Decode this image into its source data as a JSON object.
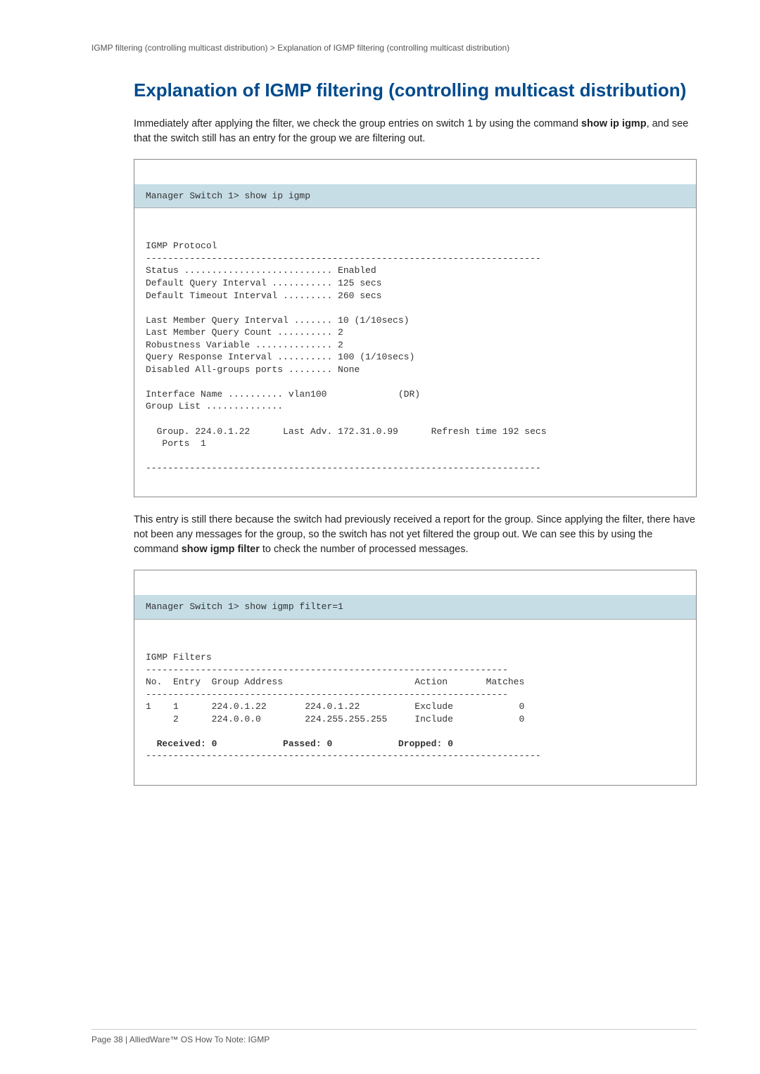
{
  "breadcrumb": "IGMP filtering (controlling multicast distribution)  >   Explanation of IGMP filtering (controlling multicast distribution)",
  "heading_part1": "Explanation of ",
  "heading_igmp": "IGMP",
  "heading_part2": " filtering (controlling multicast distribution)",
  "para1_a": "Immediately after applying the filter, we check the group entries on switch 1 by using the command ",
  "para1_cmd": "show ip igmp",
  "para1_b": ", and see that the switch still has an entry for the group we are filtering out.",
  "code1_header": "Manager Switch 1> show ip igmp",
  "code1_body": "IGMP Protocol\n------------------------------------------------------------------------\nStatus ........................... Enabled\nDefault Query Interval ........... 125 secs\nDefault Timeout Interval ......... 260 secs\n\nLast Member Query Interval ....... 10 (1/10secs)\nLast Member Query Count .......... 2\nRobustness Variable .............. 2\nQuery Response Interval .......... 100 (1/10secs)\nDisabled All-groups ports ........ None\n\nInterface Name .......... vlan100             (DR)\nGroup List ..............\n\n  Group. 224.0.1.22      Last Adv. 172.31.0.99      Refresh time 192 secs\n   Ports  1\n\n------------------------------------------------------------------------",
  "para2_a": "This entry is still there because the switch had previously received a report for the group. Since applying the filter, there have not been any messages for the group, so the switch has not yet filtered the group out. We can see this by using the command ",
  "para2_cmd": "show igmp filter",
  "para2_b": " to check the number of processed messages.",
  "code2_header": "Manager Switch 1> show igmp filter=1",
  "code2_body": "IGMP Filters\n------------------------------------------------------------------\nNo.  Entry  Group Address                        Action       Matches\n------------------------------------------------------------------\n1    1      224.0.1.22       224.0.1.22          Exclude            0\n     2      224.0.0.0        224.255.255.255     Include            0\n\n  Received: 0            Passed: 0            Dropped: 0\n------------------------------------------------------------------------",
  "footer": "Page 38 | AlliedWare™ OS How To Note: IGMP",
  "chart_data": {
    "type": "table",
    "title": "IGMP Filters",
    "columns": [
      "No.",
      "Entry",
      "Group Address Start",
      "Group Address End",
      "Action",
      "Matches"
    ],
    "rows": [
      [
        1,
        1,
        "224.0.1.22",
        "224.0.1.22",
        "Exclude",
        0
      ],
      [
        "",
        2,
        "224.0.0.0",
        "224.255.255.255",
        "Include",
        0
      ]
    ],
    "summary": {
      "Received": 0,
      "Passed": 0,
      "Dropped": 0
    },
    "igmp_protocol": {
      "Status": "Enabled",
      "Default Query Interval": "125 secs",
      "Default Timeout Interval": "260 secs",
      "Last Member Query Interval": "10 (1/10secs)",
      "Last Member Query Count": 2,
      "Robustness Variable": 2,
      "Query Response Interval": "100 (1/10secs)",
      "Disabled All-groups ports": "None",
      "Interface Name": "vlan100",
      "Interface Role": "DR",
      "Group": "224.0.1.22",
      "Last Adv": "172.31.0.99",
      "Refresh time": "192 secs",
      "Ports": 1
    }
  }
}
